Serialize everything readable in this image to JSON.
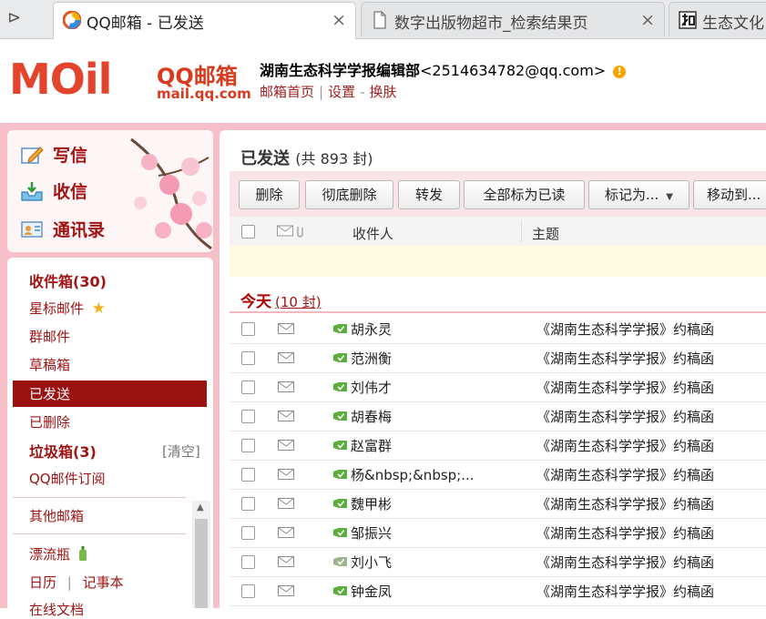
{
  "browser": {
    "tabs": [
      {
        "label": "QQ邮箱 - 已发送",
        "active": true
      },
      {
        "label": "数字出版物超市_检索结果页",
        "active": false
      },
      {
        "label": "生态文化",
        "active": false
      }
    ],
    "close_glyph": "×"
  },
  "header": {
    "logo_text": "MOil",
    "logo_brand": "QQ邮箱",
    "logo_domain": "mail.qq.com",
    "account_name": "湖南生态科学学报编辑部",
    "account_email": "<2514634782@qq.com>",
    "warning_glyph": "!",
    "links": {
      "home": "邮箱首页",
      "settings": "设置",
      "skin": "换肤"
    },
    "separators": {
      "bar": "|",
      "dash": "-"
    }
  },
  "sidebar": {
    "actions": {
      "compose": "写信",
      "inbox": "收信",
      "contacts": "通讯录"
    },
    "folders": {
      "inbox": "收件箱(30)",
      "starred": "星标邮件",
      "groups": "群邮件",
      "drafts": "草稿箱",
      "sent": "已发送",
      "deleted": "已删除",
      "spam": "垃圾箱(3)",
      "spam_clear": "[清空]",
      "subscriptions": "QQ邮件订阅",
      "other_mailbox": "其他邮箱",
      "bottle": "漂流瓶",
      "calendar": "日历",
      "calendar_sep": "|",
      "notes": "记事本",
      "online_docs": "在线文档"
    }
  },
  "main": {
    "title": "已发送",
    "count_text": "(共 893 封)",
    "toolbar": {
      "delete": "删除",
      "delete_permanently": "彻底删除",
      "forward": "转发",
      "mark_all_read": "全部标为已读",
      "mark_as": "标记为...",
      "move_to": "移动到..."
    },
    "columns": {
      "recipient": "收件人",
      "subject": "主题"
    },
    "group": {
      "label": "今天",
      "count": "(10 封)"
    },
    "emails": [
      {
        "recipient": "胡永灵",
        "subject": "《湖南生态科学学报》约稿函",
        "sent_ok": true
      },
      {
        "recipient": "范洲衡",
        "subject": "《湖南生态科学学报》约稿函",
        "sent_ok": true
      },
      {
        "recipient": "刘伟才",
        "subject": "《湖南生态科学学报》约稿函",
        "sent_ok": true
      },
      {
        "recipient": "胡春梅",
        "subject": "《湖南生态科学学报》约稿函",
        "sent_ok": true
      },
      {
        "recipient": "赵富群",
        "subject": "《湖南生态科学学报》约稿函",
        "sent_ok": true
      },
      {
        "recipient": "杨&nbsp;&nbsp;...",
        "subject": "《湖南生态科学学报》约稿函",
        "sent_ok": true
      },
      {
        "recipient": "魏甲彬",
        "subject": "《湖南生态科学学报》约稿函",
        "sent_ok": true
      },
      {
        "recipient": "邹振兴",
        "subject": "《湖南生态科学学报》约稿函",
        "sent_ok": true
      },
      {
        "recipient": "刘小飞",
        "subject": "《湖南生态科学学报》约稿函",
        "sent_ok": false
      },
      {
        "recipient": "钟金凤",
        "subject": "《湖南生态科学学报》约稿函",
        "sent_ok": true
      }
    ]
  },
  "colors": {
    "brand_red": "#a11414",
    "active_folder": "#9b1212",
    "pink_band": "#f7c0c8",
    "sent_ok": "#5cab3d",
    "sent_pending": "#9ab48e"
  }
}
